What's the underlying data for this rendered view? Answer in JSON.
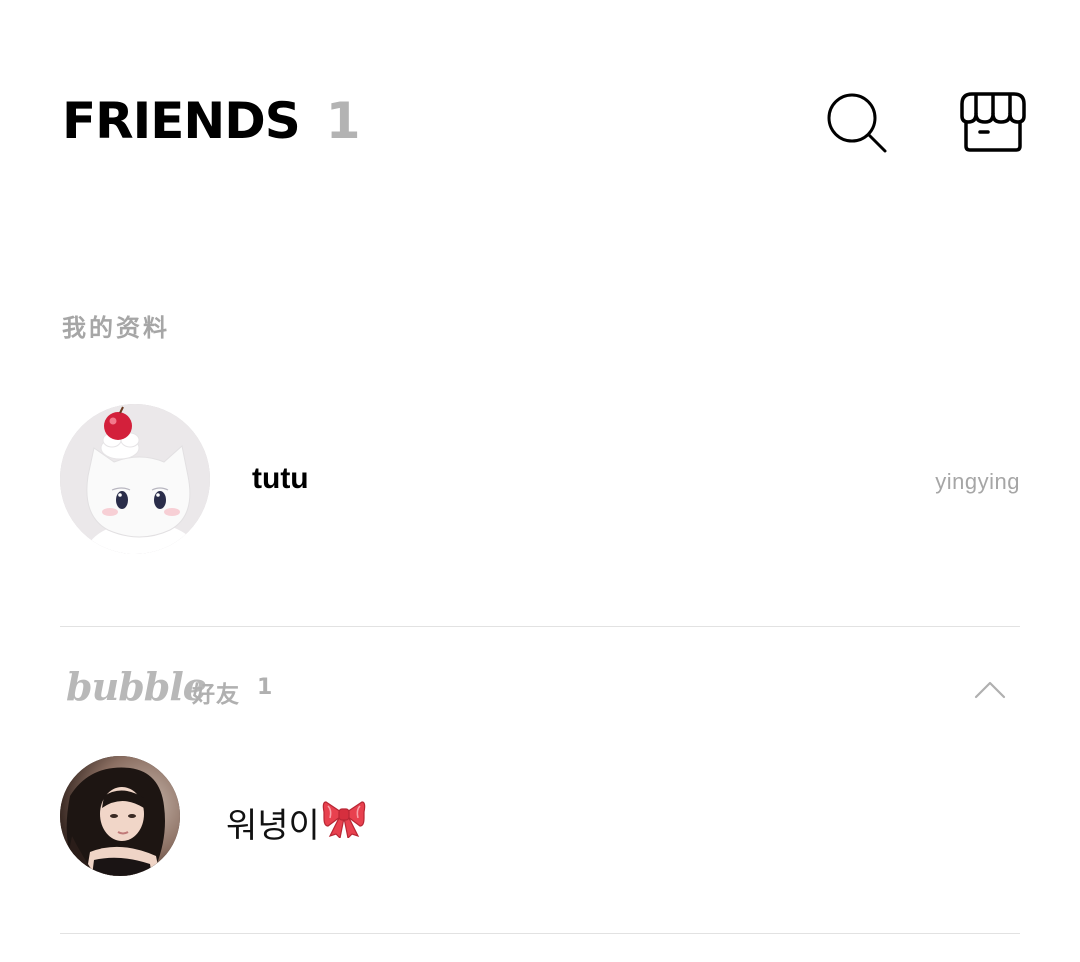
{
  "header": {
    "title": "FRIENDS",
    "count": "1",
    "search_icon": "search-icon",
    "store_icon": "store-icon"
  },
  "my_profile": {
    "section_label": "我的资料",
    "name": "tutu",
    "status_message": "yingying",
    "avatar": "plush-cat-avatar"
  },
  "group": {
    "brand": "bubble",
    "label": "好友",
    "count": "1",
    "toggle_icon": "chevron-up-icon"
  },
  "friends": [
    {
      "name": "워녕이",
      "emoji": "🎀",
      "avatar": "photo-avatar"
    }
  ],
  "colors": {
    "muted_text": "#a6a6a6",
    "divider": "#e2e2e2",
    "accent_bow": "#e8414f"
  }
}
